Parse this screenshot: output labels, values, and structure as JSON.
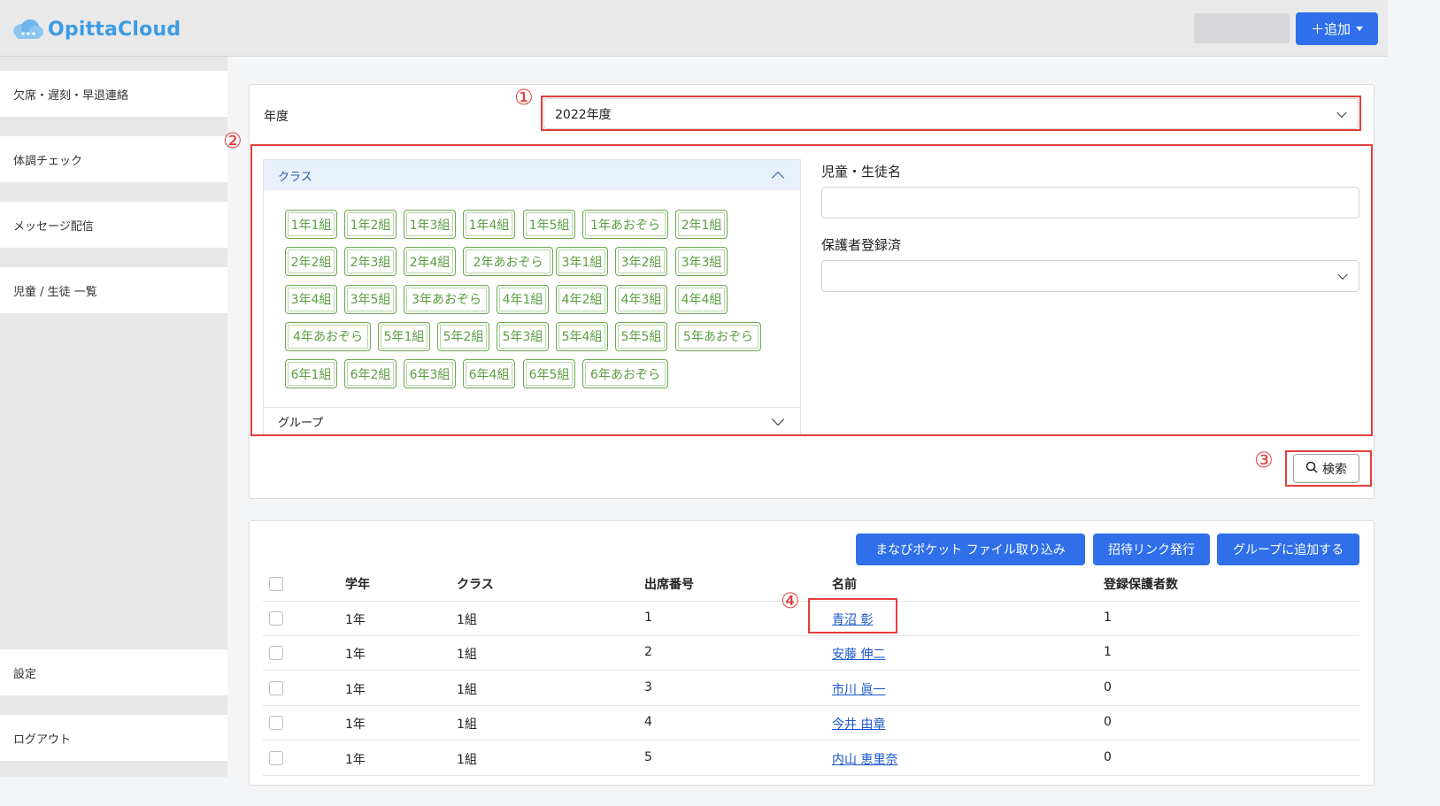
{
  "header": {
    "app_name": "OpittaCloud",
    "add_button_label": "＋追加"
  },
  "sidebar": {
    "items": [
      {
        "label": "欠席・遅刻・早退連絡"
      },
      {
        "label": "体調チェック"
      },
      {
        "label": "メッセージ配信"
      },
      {
        "label": "児童 / 生徒 一覧"
      },
      {
        "label": "設定"
      },
      {
        "label": "ログアウト"
      }
    ]
  },
  "annotations": [
    "①",
    "②",
    "③",
    "④"
  ],
  "filter": {
    "year_label": "年度",
    "year_value": "2022年度",
    "class_section_title": "クラス",
    "group_section_title": "グループ",
    "classes": [
      "1年1組",
      "1年2組",
      "1年3組",
      "1年4組",
      "1年5組",
      "1年あおぞら",
      "2年1組",
      "2年2組",
      "2年3組",
      "2年4組",
      "2年あおぞら",
      "3年1組",
      "3年2組",
      "3年3組",
      "3年4組",
      "3年5組",
      "3年あおぞら",
      "4年1組",
      "4年2組",
      "4年3組",
      "4年4組",
      "4年あおぞら",
      "5年1組",
      "5年2組",
      "5年3組",
      "5年4組",
      "5年5組",
      "5年あおぞら",
      "6年1組",
      "6年2組",
      "6年3組",
      "6年4組",
      "6年5組",
      "6年あおぞら"
    ],
    "student_name_label": "児童・生徒名",
    "student_name_value": "",
    "guardian_registered_label": "保護者登録済",
    "guardian_registered_value": "",
    "search_button_label": "検索"
  },
  "actions": {
    "import_label": "まなびポケット ファイル取り込み",
    "invite_label": "招待リンク発行",
    "add_group_label": "グループに追加する"
  },
  "table": {
    "headers": [
      "学年",
      "クラス",
      "出席番号",
      "名前",
      "登録保護者数"
    ],
    "rows": [
      {
        "grade": "1年",
        "class": "1組",
        "number": "1",
        "name": "青沼 彰",
        "guardians": "1"
      },
      {
        "grade": "1年",
        "class": "1組",
        "number": "2",
        "name": "安藤 伸二",
        "guardians": "1"
      },
      {
        "grade": "1年",
        "class": "1組",
        "number": "3",
        "name": "市川 眞一",
        "guardians": "0"
      },
      {
        "grade": "1年",
        "class": "1組",
        "number": "4",
        "name": "今井 由章",
        "guardians": "0"
      },
      {
        "grade": "1年",
        "class": "1組",
        "number": "5",
        "name": "内山 恵里奈",
        "guardians": "0"
      }
    ]
  },
  "colors": {
    "accent_blue": "#2f6fe9",
    "chip_green": "#6aa84f",
    "annotation_red": "#e43d3a",
    "link_blue": "#1a56c9"
  }
}
